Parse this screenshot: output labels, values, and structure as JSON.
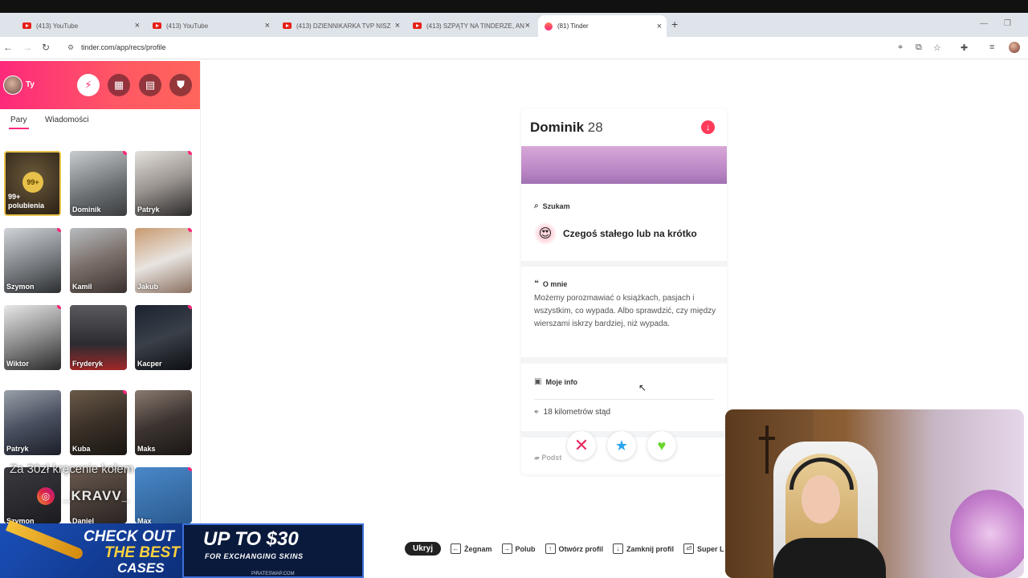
{
  "browser": {
    "tabs": [
      {
        "title": "(413) YouTube",
        "type": "youtube"
      },
      {
        "title": "(413) YouTube",
        "type": "youtube"
      },
      {
        "title": "(413) DZIENNIKARKA TVP NISZ",
        "type": "youtube"
      },
      {
        "title": "(413) SZPĄTY NA TINDERZE, AN",
        "type": "youtube"
      },
      {
        "title": "(81) Tinder",
        "type": "tinder",
        "active": true
      }
    ],
    "url": "tinder.com/app/recs/profile",
    "close_glyph": "×",
    "new_tab_glyph": "+"
  },
  "sidebar": {
    "username": "Ty",
    "tabs": [
      "Pary",
      "Wiadomości"
    ],
    "likes_badge": "99+",
    "likes_label_1": "99+",
    "likes_label_2": "polubienia",
    "matches": [
      "Dominik",
      "Patryk",
      "Szymon",
      "Kamil",
      "Jakub",
      "Wiktor",
      "Fryderyk",
      "Kacper",
      "Patryk",
      "Kuba",
      "Maks"
    ],
    "partial_matches": [
      "Szymon",
      "Daniel",
      "Max"
    ]
  },
  "overlay": {
    "text": "Za 30zł kręcenie kołem",
    "instagram_handle": "_KRAVV_"
  },
  "ad": {
    "left_line1": "CHECK OUT",
    "left_line2": "THE BEST",
    "left_line3": "CASES",
    "right_line1": "UP TO $30",
    "right_line2": "FOR EXCHANGING SKINS",
    "right_line3": "PIRATESWAP.COM"
  },
  "profile": {
    "name": "Dominik",
    "age": "28",
    "looking_title": "Szukam",
    "looking_value": "Czegoś stałego lub na krótko",
    "about_title": "O mnie",
    "about_text": "Możemy porozmawiać o książkach, pasjach i wszystkim, co wypada. Albo sprawdzić, czy między wierszami iskrzy bardziej, niż wypada.",
    "info_title": "Moje info",
    "distance": "18 kilometrów stąd",
    "basics_partial": "Podst"
  },
  "shortcuts": {
    "hide": "Ukryj",
    "items": [
      "Żegnam",
      "Polub",
      "Otwórz profil",
      "Zamknij profil",
      "Super L"
    ]
  },
  "colors": {
    "brand_start": "#fd297b",
    "brand_end": "#ff655b",
    "nope": "#e8285e",
    "super_like": "#2aa4f0",
    "like": "#6bd62a"
  }
}
